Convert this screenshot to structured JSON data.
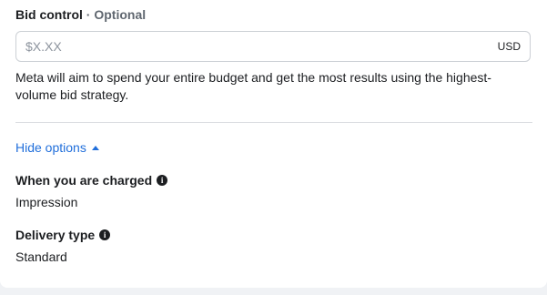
{
  "bid_control": {
    "title": "Bid control",
    "separator": "·",
    "optional_label": "Optional",
    "input_placeholder": "$X.XX",
    "input_value": "",
    "currency": "USD",
    "description": "Meta will aim to spend your entire budget and get the most results using the highest-volume bid strategy."
  },
  "options_toggle": {
    "label": "Hide options",
    "icon": "caret-up-icon"
  },
  "when_charged": {
    "label": "When you are charged",
    "info_icon": "info-icon",
    "value": "Impression"
  },
  "delivery_type": {
    "label": "Delivery type",
    "info_icon": "info-icon",
    "value": "Standard"
  },
  "colors": {
    "link": "#216fdb",
    "text": "#1c1e21",
    "secondary_text": "#606770",
    "border": "#ccd0d5"
  }
}
